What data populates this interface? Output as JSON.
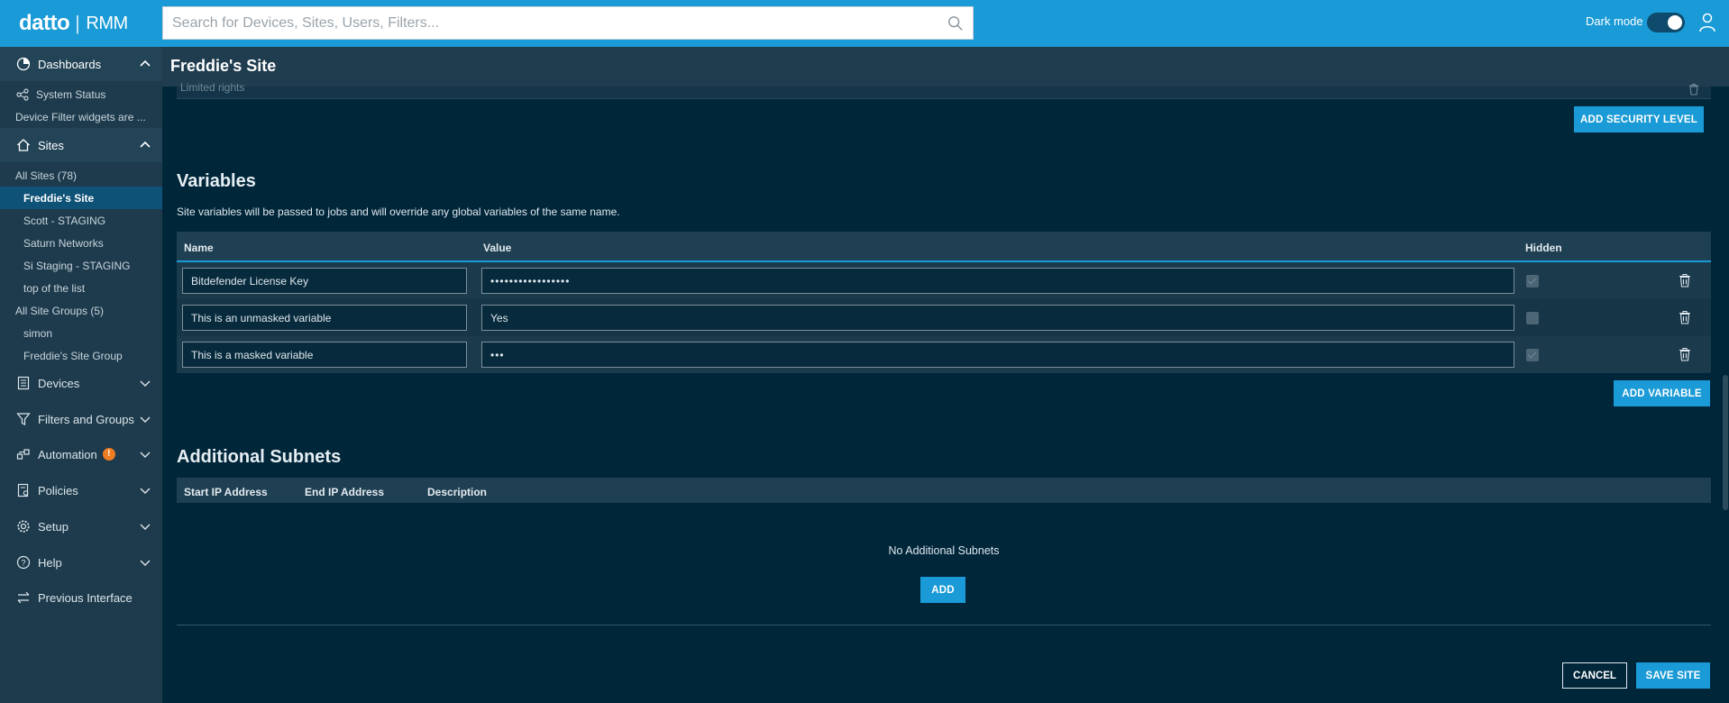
{
  "topbar": {
    "logo": "datto",
    "logo_separator": "|",
    "logo_product": "RMM",
    "search_placeholder": "Search for Devices, Sites, Users, Filters...",
    "dark_mode_label": "Dark mode",
    "dark_mode_on": true
  },
  "sidebar": {
    "dashboards": {
      "label": "Dashboards",
      "items": [
        "System Status",
        "Device Filter widgets are ..."
      ]
    },
    "sites": {
      "label": "Sites",
      "all_sites": "All Sites (78)",
      "site_items": [
        "Freddie's Site",
        "Scott - STAGING",
        "Saturn Networks",
        "Si Staging - STAGING",
        "top of the list"
      ],
      "active_site": "Freddie's Site",
      "all_site_groups": "All Site Groups (5)",
      "group_items": [
        "simon",
        "Freddie's Site Group"
      ]
    },
    "nav": [
      {
        "label": "Devices",
        "icon": "devices-icon"
      },
      {
        "label": "Filters and Groups",
        "icon": "filter-icon"
      },
      {
        "label": "Automation",
        "icon": "automation-icon",
        "badge": "!"
      },
      {
        "label": "Policies",
        "icon": "policies-icon"
      },
      {
        "label": "Setup",
        "icon": "gear-icon"
      },
      {
        "label": "Help",
        "icon": "help-icon"
      },
      {
        "label": "Previous Interface",
        "icon": "switch-icon"
      }
    ]
  },
  "page": {
    "title": "Freddie's Site",
    "cut_off_row": "Limited rights",
    "add_security_level": "ADD SECURITY LEVEL"
  },
  "variables": {
    "title": "Variables",
    "description": "Site variables will be passed to jobs and will override any global variables of the same name.",
    "columns": {
      "name": "Name",
      "value": "Value",
      "hidden": "Hidden"
    },
    "rows": [
      {
        "name": "Bitdefender License Key",
        "value": "•••••••••••••••••",
        "hidden": true
      },
      {
        "name": "This is an unmasked variable",
        "value": "Yes",
        "hidden": false
      },
      {
        "name": "This is a masked variable",
        "value": "•••",
        "hidden": true
      }
    ],
    "add_button": "ADD VARIABLE"
  },
  "subnets": {
    "title": "Additional Subnets",
    "columns": {
      "start": "Start IP Address",
      "end": "End IP Address",
      "description": "Description"
    },
    "empty_message": "No Additional Subnets",
    "add_button": "ADD"
  },
  "footer": {
    "cancel": "CANCEL",
    "save": "SAVE SITE"
  },
  "colors": {
    "accent": "#1a9ad6",
    "background": "#00263a",
    "sidebar": "#1e3b4d",
    "badge": "#f07c22"
  }
}
